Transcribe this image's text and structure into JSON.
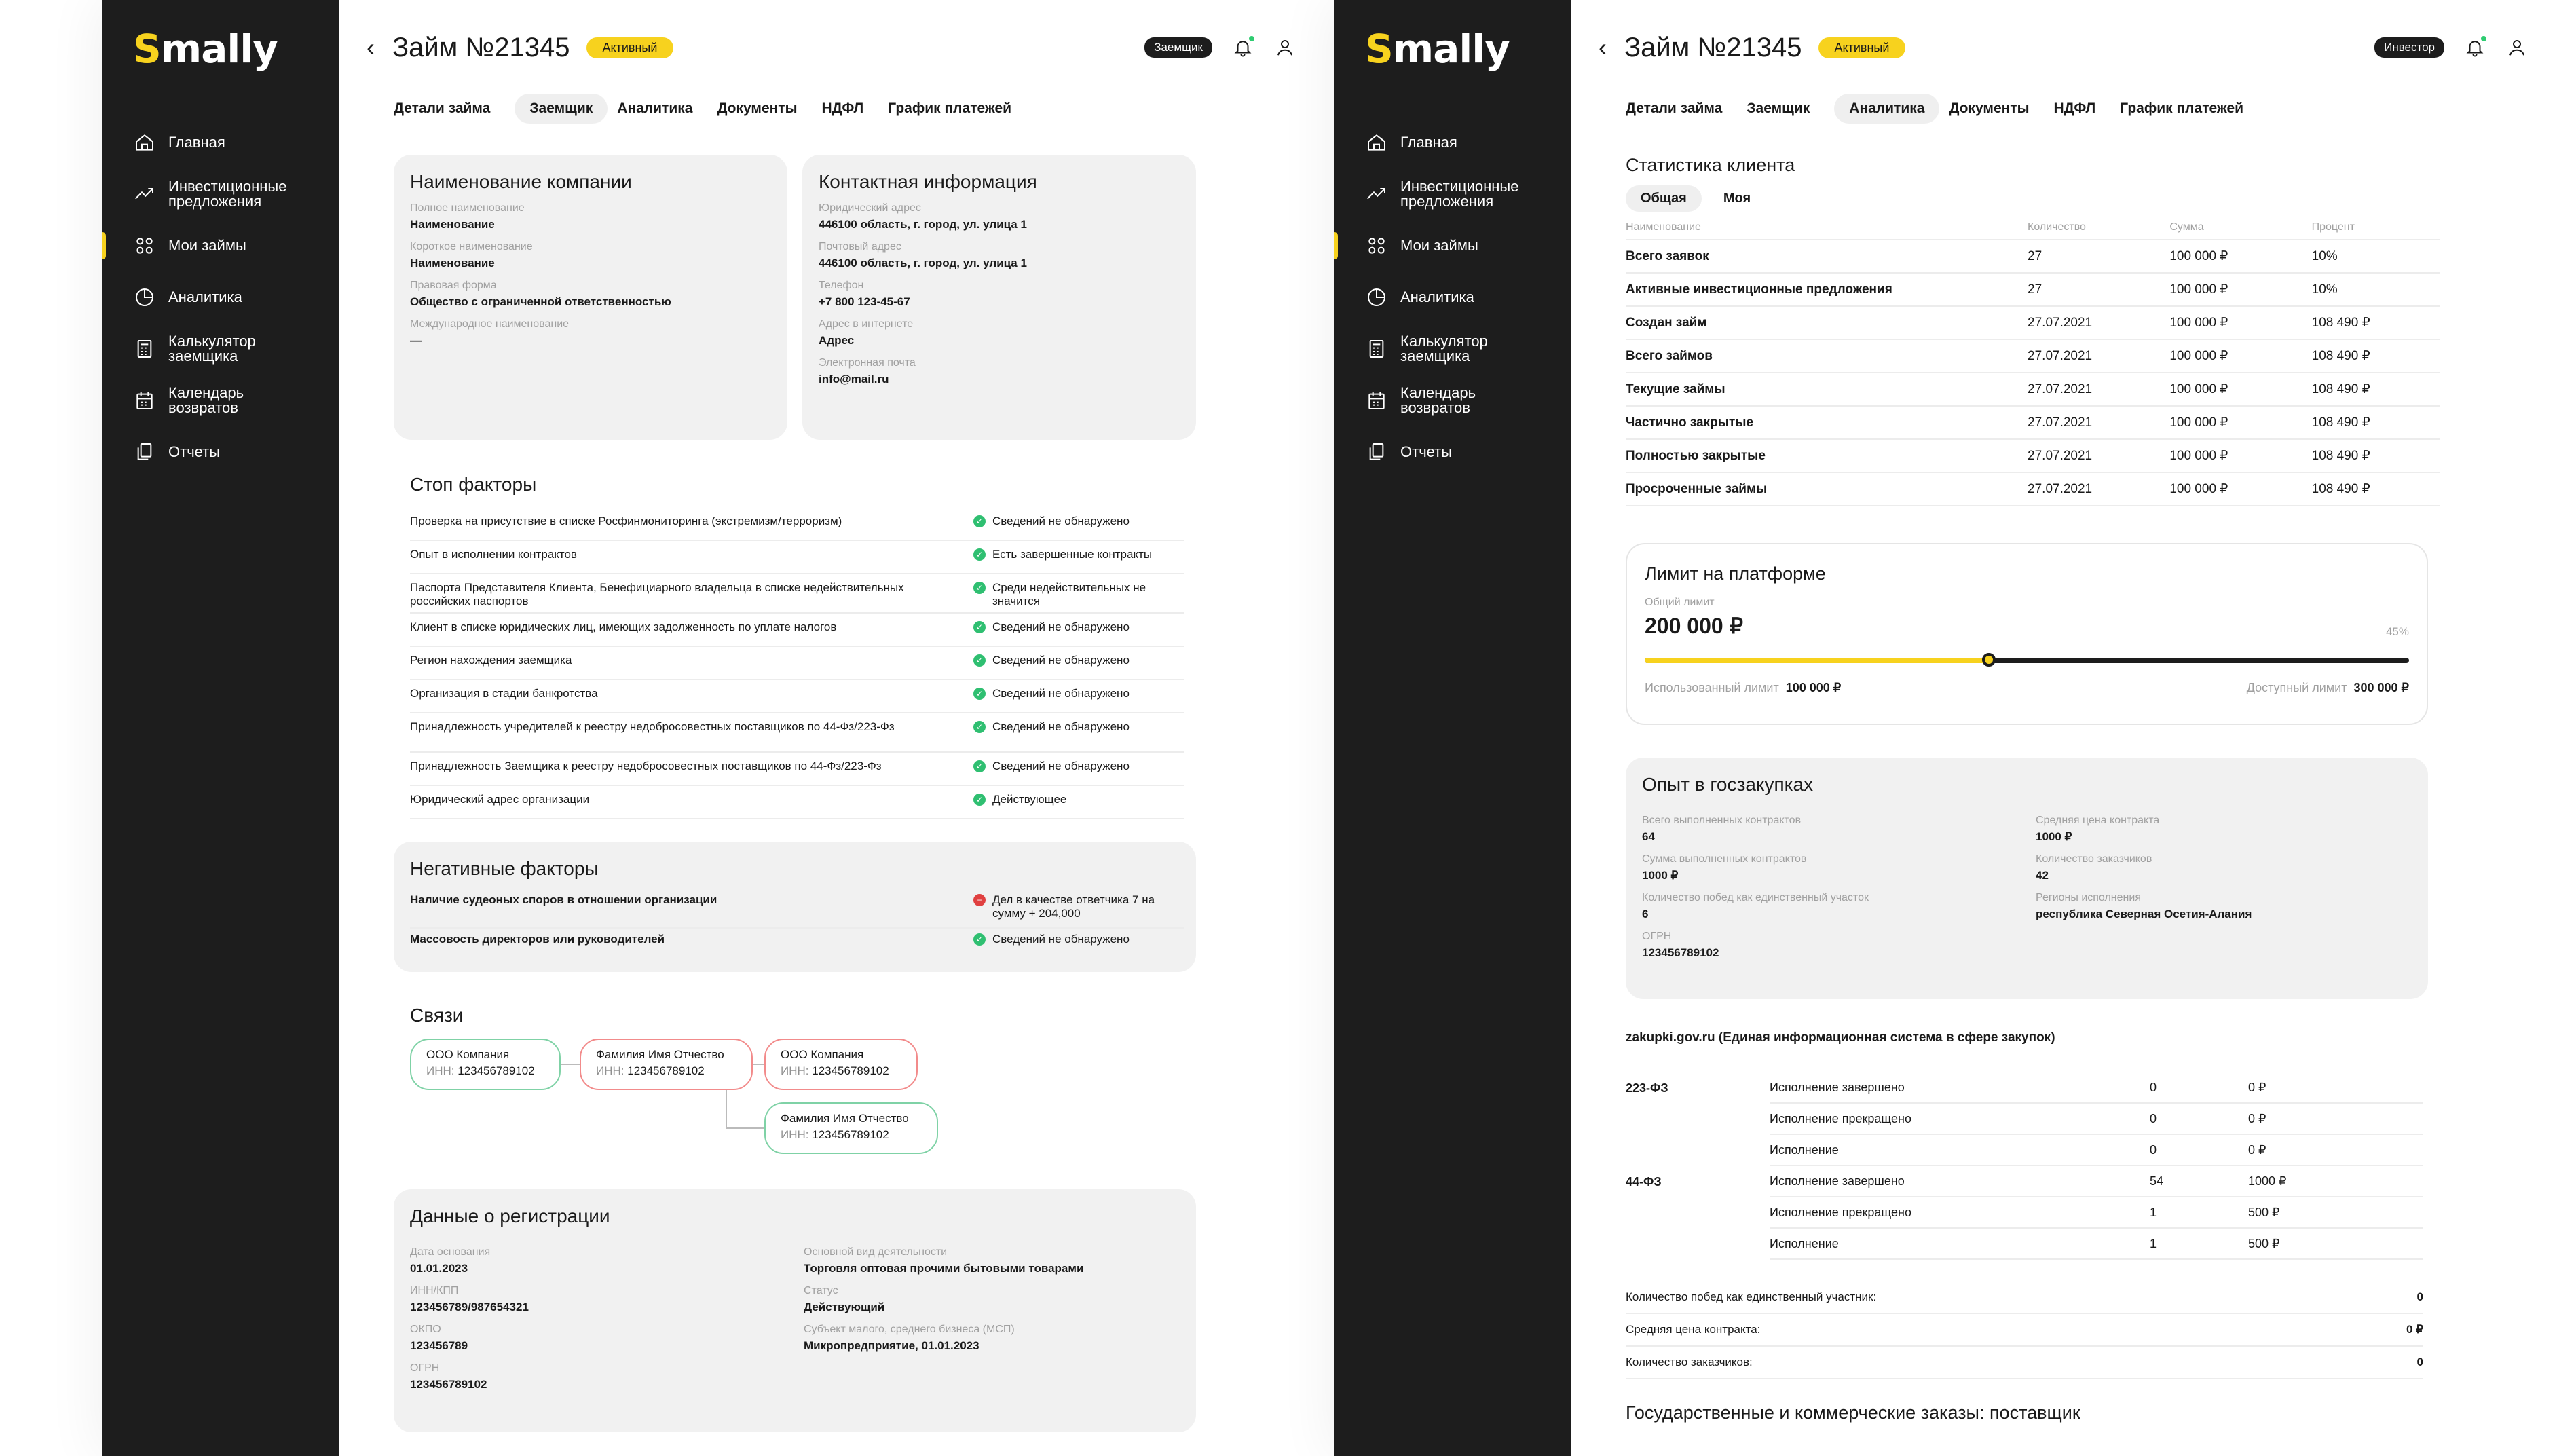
{
  "colors": {
    "accent": "#f7d21e",
    "sidebar": "#1d1d1d",
    "ok": "#2fbf71",
    "bad": "#e04040"
  },
  "sidebar": {
    "logo": "mally",
    "logo_s": "S",
    "items": [
      {
        "label": "Главная",
        "icon": "home-icon"
      },
      {
        "label": "Инвестиционные предложения",
        "icon": "trend-icon"
      },
      {
        "label": "Мои займы",
        "icon": "grid-icon"
      },
      {
        "label": "Аналитика",
        "icon": "pie-icon"
      },
      {
        "label": "Калькулятор заемщика",
        "icon": "calculator-icon"
      },
      {
        "label": "Календарь возвратов",
        "icon": "calendar-icon"
      },
      {
        "label": "Отчеты",
        "icon": "reports-icon"
      }
    ]
  },
  "left": {
    "title": "Займ №21345",
    "status": "Активный",
    "role": "Заемщик",
    "tabs": [
      "Детали займа",
      "Заемщик",
      "Аналитика",
      "Документы",
      "НДФЛ",
      "График платежей"
    ],
    "company": {
      "header": "Наименование компании",
      "fields": [
        {
          "label": "Полное наименование",
          "value": "Наименование"
        },
        {
          "label": "Короткое наименование",
          "value": "Наименование"
        },
        {
          "label": "Правовая форма",
          "value": "Общество с ограниченной ответственностью"
        },
        {
          "label": "Международное наименование",
          "value": "—"
        }
      ]
    },
    "contact": {
      "header": "Контактная информация",
      "fields": [
        {
          "label": "Юридический адрес",
          "value": "446100 область, г. город, ул. улица 1"
        },
        {
          "label": "Почтовый адрес",
          "value": "446100 область, г. город, ул. улица 1"
        },
        {
          "label": "Телефон",
          "value": "+7 800 123-45-67"
        },
        {
          "label": "Адрес в интернете",
          "value": "Адрес"
        },
        {
          "label": "Электронная почта",
          "value": "info@mail.ru"
        }
      ]
    },
    "stop": {
      "header": "Стоп факторы",
      "rows": [
        {
          "text": "Проверка на присутствие в списке Росфинмониторинга (экстремизм/терроризм)",
          "status": "Сведений не обнаружено"
        },
        {
          "text": "Опыт в исполнении контрактов",
          "status": "Есть завершенные контракты"
        },
        {
          "text": "Паспорта Представителя Клиента, Бенефициарного владельца в списке недействительных российских паспортов",
          "status": "Среди недействительных не значится"
        },
        {
          "text": "Клиент в списке юридических лиц, имеющих задолженность по уплате налогов",
          "status": "Сведений не обнаружено"
        },
        {
          "text": "Регион нахождения заемщика",
          "status": "Сведений не обнаружено"
        },
        {
          "text": "Организация в стадии банкротства",
          "status": "Сведений не обнаружено"
        },
        {
          "text": "Принадлежность учредителей к реестру недобросовестных поставщиков по 44-Фз/223-Фз",
          "status": "Сведений не обнаружено"
        },
        {
          "text": "Принадлежность Заемщика к реестру недобросовестных поставщиков по 44-Фз/223-Фз",
          "status": "Сведений не обнаружено"
        },
        {
          "text": "Юридический адрес организации",
          "status": "Действующее"
        }
      ]
    },
    "negative": {
      "header": "Негативные факторы",
      "rows": [
        {
          "text": "Наличие судеоных споров в отношении организации",
          "status": "Дел в качестве ответчика 7 на сумму + 204,000"
        },
        {
          "text": "Массовость директоров или руководителей",
          "status": "Сведений не обнаружено"
        }
      ]
    },
    "links": {
      "header": "Связи",
      "inn_label": "ИНН:",
      "nodes": [
        {
          "name": "ООО Компания",
          "inn": "123456789102"
        },
        {
          "name": "Фамилия Имя Отчество",
          "inn": "123456789102"
        },
        {
          "name": "ООО Компания",
          "inn": "123456789102"
        },
        {
          "name": "Фамилия Имя Отчество",
          "inn": "123456789102"
        }
      ]
    },
    "registration": {
      "header": "Данные о регистрации",
      "left": [
        {
          "label": "Дата основания",
          "value": "01.01.2023"
        },
        {
          "label": "ИНН/КПП",
          "value": "123456789/987654321"
        },
        {
          "label": "ОКПО",
          "value": "123456789"
        },
        {
          "label": "ОГРН",
          "value": "123456789102"
        }
      ],
      "right": [
        {
          "label": "Основной вид деятельности",
          "value": "Торговля оптовая прочими бытовыми товарами"
        },
        {
          "label": "Статус",
          "value": "Действующий"
        },
        {
          "label": "Субъект малого, среднего бизнеса (МСП)",
          "value": "Микропредприятие, 01.01.2023"
        }
      ]
    }
  },
  "right": {
    "title": "Займ №21345",
    "status": "Активный",
    "role": "Инвестор",
    "tabs": [
      "Детали займа",
      "Заемщик",
      "Аналитика",
      "Документы",
      "НДФЛ",
      "График платежей"
    ],
    "stats": {
      "header": "Статистика клиента",
      "switch": [
        "Общая",
        "Моя"
      ],
      "columns": [
        "Наименование",
        "Количество",
        "Сумма",
        "Процент"
      ],
      "rows": [
        [
          "Всего заявок",
          "27",
          "100 000 ₽",
          "10%"
        ],
        [
          "Активные инвестиционные предложения",
          "27",
          "100 000 ₽",
          "10%"
        ],
        [
          "Создан займ",
          "27.07.2021",
          "100 000 ₽",
          "108 490 ₽"
        ],
        [
          "Всего займов",
          "27.07.2021",
          "100 000 ₽",
          "108 490 ₽"
        ],
        [
          "Текущие займы",
          "27.07.2021",
          "100 000 ₽",
          "108 490 ₽"
        ],
        [
          "Частично закрытые",
          "27.07.2021",
          "100 000 ₽",
          "108 490 ₽"
        ],
        [
          "Полностью закрытые",
          "27.07.2021",
          "100 000 ₽",
          "108 490 ₽"
        ],
        [
          "Просроченные займы",
          "27.07.2021",
          "100 000 ₽",
          "108 490 ₽"
        ]
      ]
    },
    "limit": {
      "header": "Лимит на платформе",
      "total_label": "Общий лимит",
      "total": "200 000 ₽",
      "percent_label": "45%",
      "progress": 0.45,
      "used_label": "Использованный лимит",
      "used": "100 000 ₽",
      "avail_label": "Доступный лимит",
      "avail": "300 000 ₽"
    },
    "exp": {
      "header": "Опыт в госзакупках",
      "left": [
        {
          "label": "Всего выполненных контрактов",
          "value": "64"
        },
        {
          "label": "Сумма выполненных контрактов",
          "value": "1000 ₽"
        },
        {
          "label": "Количество побед как единственный участок",
          "value": "6"
        },
        {
          "label": "ОГРН",
          "value": "123456789102"
        }
      ],
      "right": [
        {
          "label": "Средняя цена контракта",
          "value": "1000 ₽"
        },
        {
          "label": "Количество заказчиков",
          "value": "42"
        },
        {
          "label": "Регионы исполнения",
          "value": "республика Северная Осетия-Алания"
        }
      ]
    },
    "zakupki": {
      "header": "zakupki.gov.ru (Единая информационная система в сфере закупок)",
      "rows": [
        [
          "223-ФЗ",
          "Исполнение завершено",
          "0",
          "0 ₽"
        ],
        [
          "",
          "Исполнение прекращено",
          "0",
          "0 ₽"
        ],
        [
          "",
          "Исполнение",
          "0",
          "0 ₽"
        ],
        [
          "44-ФЗ",
          "Исполнение завершено",
          "54",
          "1000 ₽"
        ],
        [
          "",
          "Исполнение прекращено",
          "1",
          "500 ₽"
        ],
        [
          "",
          "Исполнение",
          "1",
          "500 ₽"
        ]
      ],
      "summary": [
        {
          "label": "Количество побед как единственный участник:",
          "value": "0"
        },
        {
          "label": "Средняя цена контракта:",
          "value": "0 ₽"
        },
        {
          "label": "Количество заказчиков:",
          "value": "0"
        }
      ],
      "footer": "Государственные и коммерческие заказы: поставщик"
    }
  }
}
